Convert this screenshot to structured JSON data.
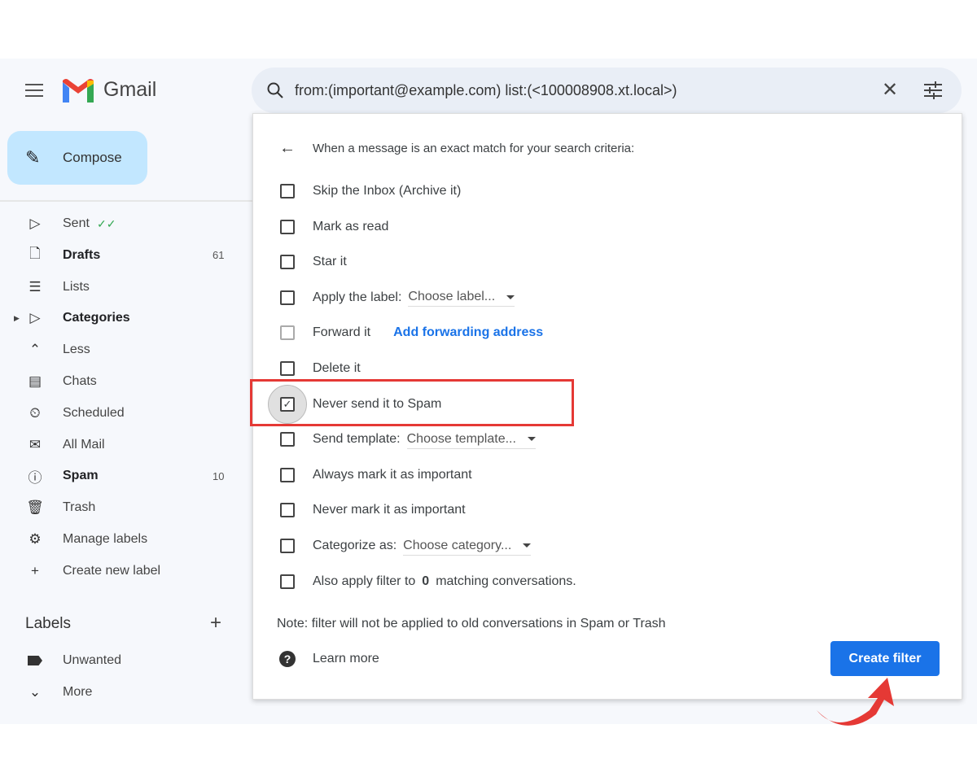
{
  "app": {
    "name": "Gmail",
    "brand_colors": {
      "red": "#ea4335",
      "blue": "#4285f4",
      "green": "#34a853",
      "yellow": "#fbbc04"
    }
  },
  "compose": {
    "label": "Compose"
  },
  "search": {
    "query": "from:(important@example.com) list:(<100008908.xt.local>)"
  },
  "sidebar": {
    "items": [
      {
        "label": "Sent",
        "icon": "send-icon"
      },
      {
        "label": "Drafts",
        "count": "61",
        "bold": true,
        "icon": "draft-icon"
      },
      {
        "label": "Lists",
        "icon": "list-icon"
      },
      {
        "label": "Categories",
        "bold": true,
        "icon": "label-icon"
      },
      {
        "label": "Less",
        "icon": "chevron-up-icon"
      },
      {
        "label": "Chats",
        "icon": "chat-icon"
      },
      {
        "label": "Scheduled",
        "icon": "scheduled-icon"
      },
      {
        "label": "All Mail",
        "icon": "all-mail-icon"
      },
      {
        "label": "Spam",
        "count": "10",
        "bold": true,
        "icon": "spam-icon"
      },
      {
        "label": "Trash",
        "icon": "trash-icon"
      },
      {
        "label": "Manage labels",
        "icon": "gear-icon"
      },
      {
        "label": "Create new label",
        "icon": "plus-icon"
      }
    ],
    "labels_header": "Labels",
    "labels": [
      {
        "label": "Unwanted"
      },
      {
        "label": "More"
      }
    ]
  },
  "filter": {
    "header": "When a message is an exact match for your search criteria:",
    "options": [
      {
        "label": "Skip the Inbox (Archive it)",
        "checked": false
      },
      {
        "label": "Mark as read",
        "checked": false
      },
      {
        "label": "Star it",
        "checked": false
      },
      {
        "label": "Apply the label:",
        "checked": false,
        "select": "Choose label..."
      },
      {
        "label": "Forward it",
        "checked": false,
        "disabled": true,
        "link": "Add forwarding address"
      },
      {
        "label": "Delete it",
        "checked": false
      },
      {
        "label": "Never send it to Spam",
        "checked": true
      },
      {
        "label": "Send template:",
        "checked": false,
        "select": "Choose template..."
      },
      {
        "label": "Always mark it as important",
        "checked": false
      },
      {
        "label": "Never mark it as important",
        "checked": false
      },
      {
        "label": "Categorize as:",
        "checked": false,
        "select": "Choose category..."
      },
      {
        "label_pre": "Also apply filter to",
        "count": "0",
        "label_post": "matching conversations.",
        "checked": false
      }
    ],
    "note": "Note: filter will not be applied to old conversations in Spam or Trash",
    "learn_more": "Learn more",
    "create_button": "Create filter",
    "accent": "#1a73e8",
    "highlight_color": "#e53935"
  }
}
